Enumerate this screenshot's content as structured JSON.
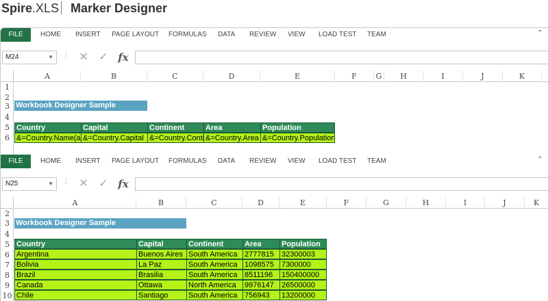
{
  "header": {
    "brand_bold": "Spire",
    "brand_rest": ".XLS",
    "title": "Marker Designer"
  },
  "ribbon": {
    "tabs": [
      "FILE",
      "HOME",
      "INSERT",
      "PAGE LAYOUT",
      "FORMULAS",
      "DATA",
      "REVIEW",
      "VIEW",
      "LOAD TEST",
      "TEAM"
    ]
  },
  "pane1": {
    "name_box": "M24",
    "columns": [
      "A",
      "B",
      "C",
      "D",
      "E",
      "F",
      "G",
      "H",
      "I",
      "J",
      "K"
    ],
    "rows": [
      "1",
      "2",
      "3",
      "4",
      "5",
      "6"
    ],
    "sheet_title": "Workbook Designer Sample",
    "headers": [
      "Country",
      "Capital",
      "Continent",
      "Area",
      "Population"
    ],
    "markers": [
      "&=Country.Name(add)",
      "&=Country.Capital",
      "&=Country.Continent",
      "&=Country.Area",
      "&=Country.Population"
    ]
  },
  "pane2": {
    "name_box": "N25",
    "columns": [
      "A",
      "B",
      "C",
      "D",
      "E",
      "F",
      "G",
      "H",
      "I",
      "J",
      "K"
    ],
    "rows": [
      "2",
      "3",
      "4",
      "5",
      "6",
      "7",
      "8",
      "9",
      "10"
    ],
    "sheet_title": "Workbook Designer Sample",
    "headers": [
      "Country",
      "Capital",
      "Continent",
      "Area",
      "Population"
    ],
    "data_rows": [
      [
        "Argentina",
        "Buenos Aires",
        "South America",
        "2777815",
        "32300003"
      ],
      [
        "Bolivia",
        "La Paz",
        "South America",
        "1098575",
        "7300000"
      ],
      [
        "Brazil",
        "Brasilia",
        "South America",
        "8511196",
        "150400000"
      ],
      [
        "Canada",
        "Ottawa",
        "North America",
        "9976147",
        "26500000"
      ],
      [
        "Chile",
        "Santiago",
        "South America",
        "756943",
        "13200000"
      ]
    ]
  }
}
